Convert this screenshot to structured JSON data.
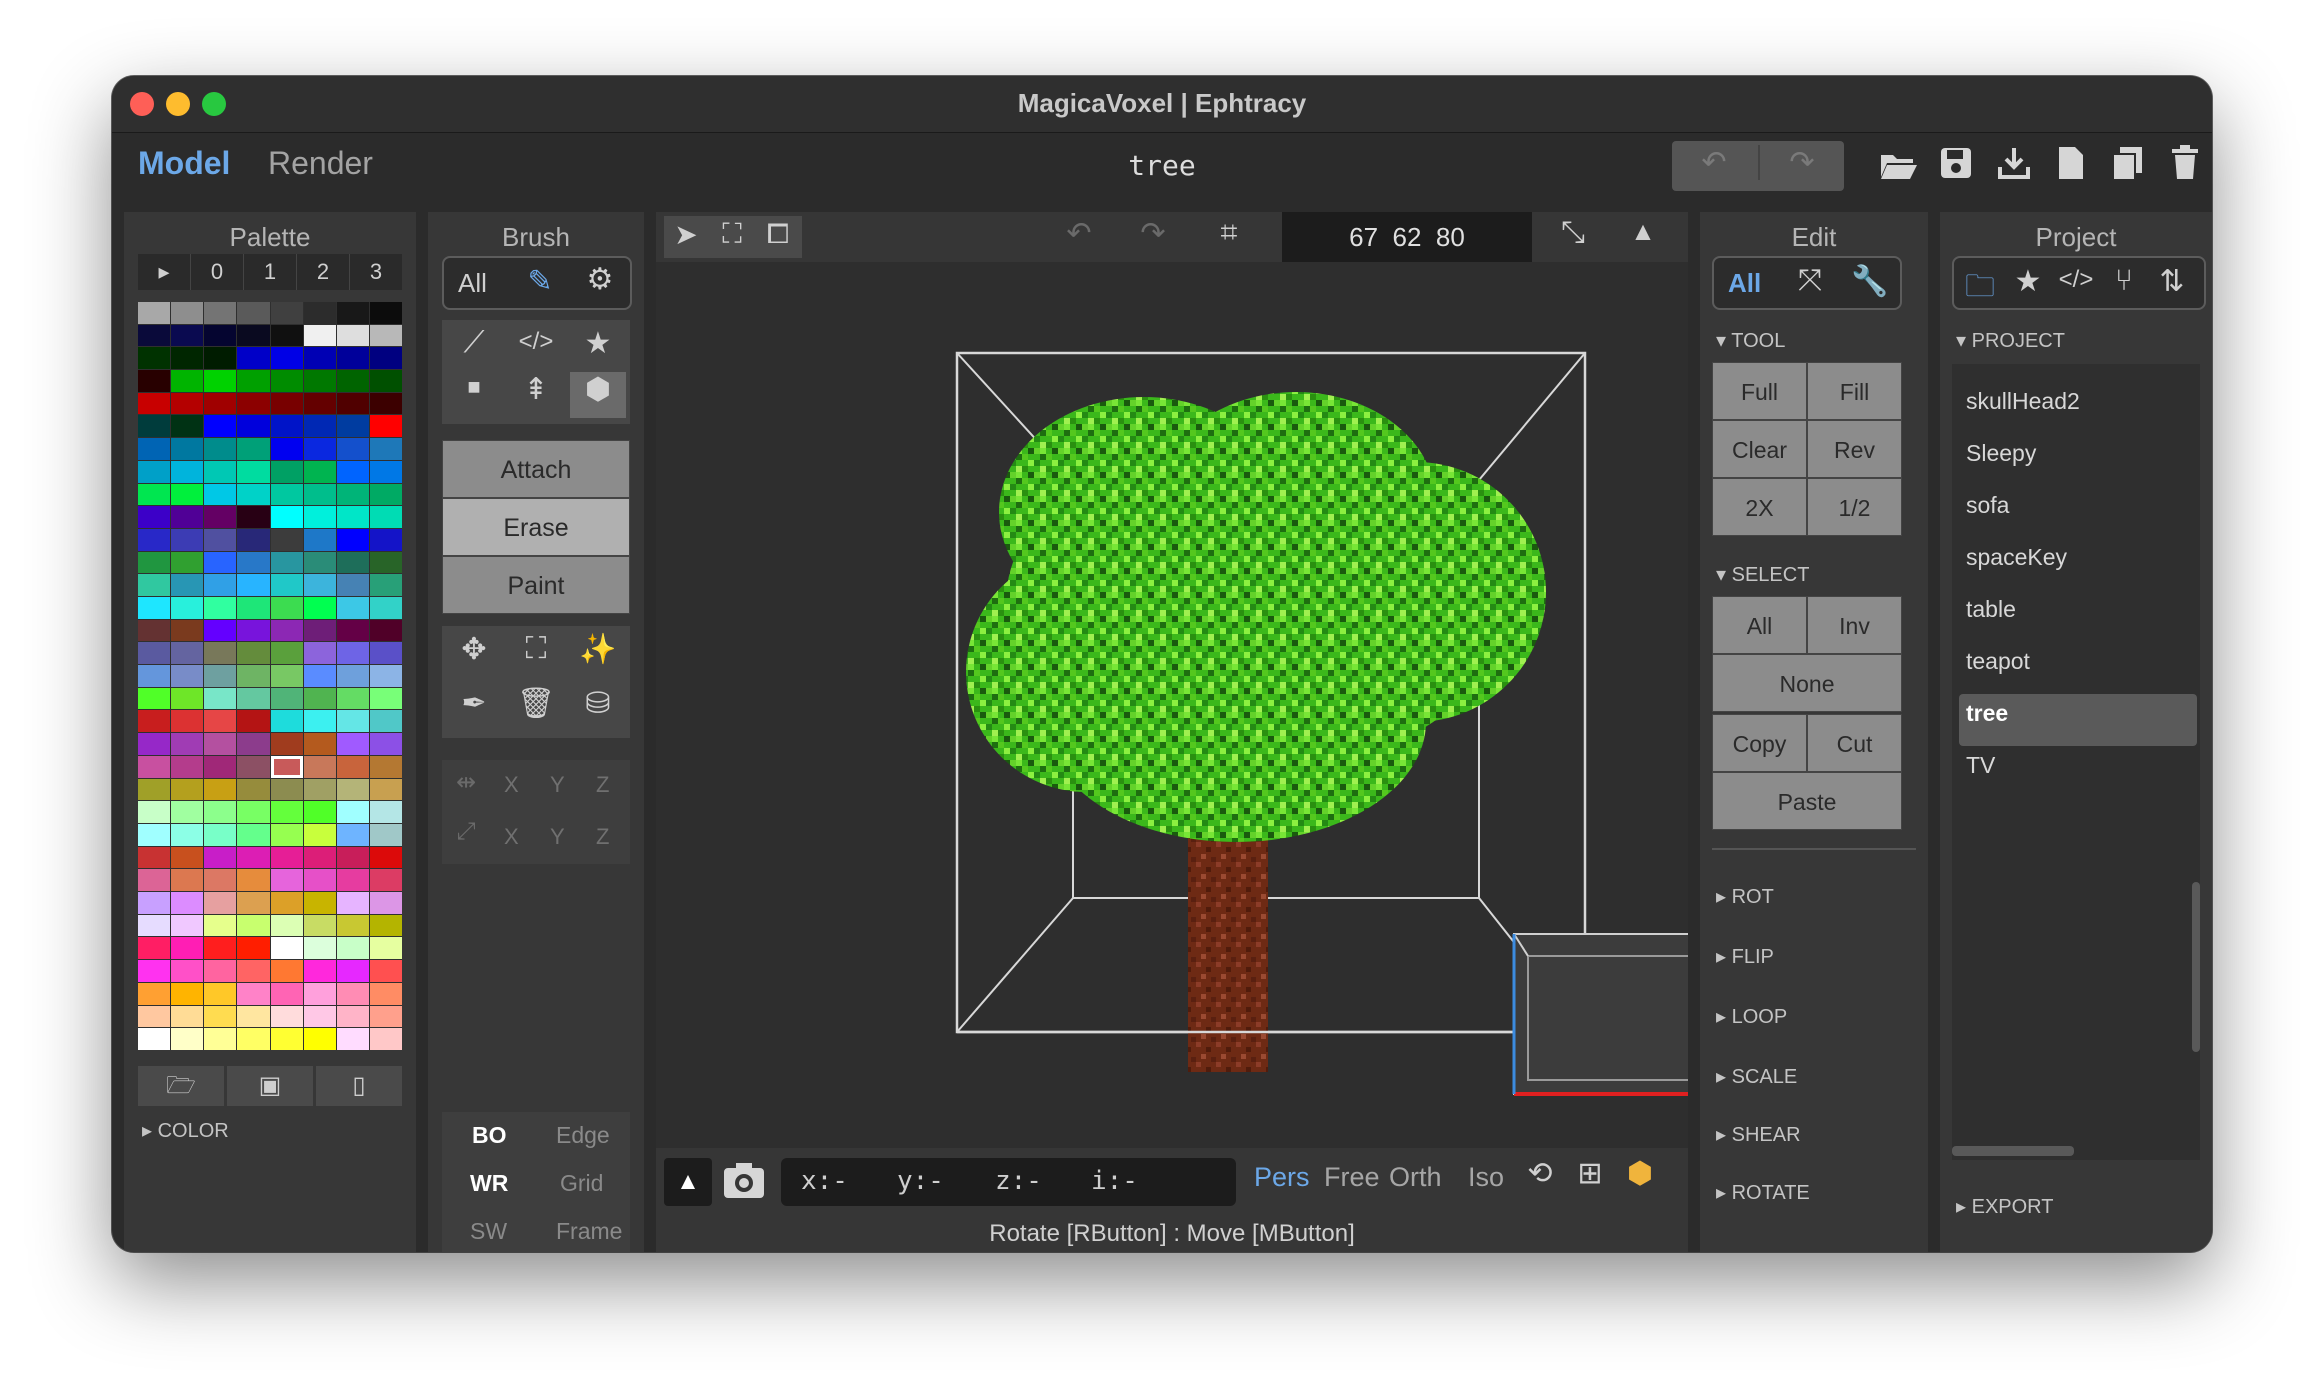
{
  "window": {
    "title": "MagicaVoxel | Ephtracy"
  },
  "menubar": {
    "mode_model": "Model",
    "mode_render": "Render",
    "document_title": "tree"
  },
  "palette": {
    "title": "Palette",
    "tabs": [
      "▸",
      "0",
      "1",
      "2",
      "3"
    ],
    "footer_label": "COLOR",
    "selected_index": 164,
    "colors": [
      "#a8a8a8",
      "#8e8e8e",
      "#747474",
      "#5a5a5a",
      "#404040",
      "#2c2c2c",
      "#181818",
      "#0c0c0c",
      "#0a0a3a",
      "#0a0a50",
      "#050530",
      "#0a0a20",
      "#101010",
      "#f0f0f0",
      "#dedede",
      "#b8b8b8",
      "#003200",
      "#002600",
      "#001c00",
      "#0000c8",
      "#0000e6",
      "#0000b4",
      "#00009a",
      "#000080",
      "#280000",
      "#00b400",
      "#00d200",
      "#00a000",
      "#008c00",
      "#007800",
      "#006400",
      "#005000",
      "#c80000",
      "#b40000",
      "#a00000",
      "#8c0000",
      "#780000",
      "#640000",
      "#500000",
      "#3c0000",
      "#003c3c",
      "#003214",
      "#0000ff",
      "#0000dc",
      "#0014c8",
      "#0028b4",
      "#003ca0",
      "#ff0000",
      "#0064b4",
      "#0078a0",
      "#008c8c",
      "#00a078",
      "#0000f0",
      "#0a28e0",
      "#1450cc",
      "#1e78b8",
      "#00a0c8",
      "#00b4dc",
      "#00c8b4",
      "#00dca0",
      "#00a064",
      "#00b450",
      "#0064ff",
      "#0078e6",
      "#00e650",
      "#00f03c",
      "#00c8e6",
      "#00d2c8",
      "#00c8a0",
      "#00be8c",
      "#00b478",
      "#00aa64",
      "#3c00c8",
      "#500096",
      "#640064",
      "#280014",
      "#00ffff",
      "#00f0dc",
      "#00e6c8",
      "#00dcb4",
      "#2828c8",
      "#3c3cb4",
      "#5050a0",
      "#282878",
      "#3c3c3c",
      "#1e78c8",
      "#0000ff",
      "#1414c8",
      "#209640",
      "#30a030",
      "#2864ff",
      "#2878c8",
      "#2896a0",
      "#2a8c78",
      "#1e6e5a",
      "#286428",
      "#30c8a0",
      "#2896b4",
      "#30a0e6",
      "#28b4ff",
      "#20c8c8",
      "#3cb4dc",
      "#4682b4",
      "#28a078",
      "#1ee6ff",
      "#28f0dc",
      "#30ffa0",
      "#1ee678",
      "#3cdc50",
      "#00ff50",
      "#3cc8e6",
      "#32d2c8",
      "#643232",
      "#7a3a1e",
      "#6400ff",
      "#7814dc",
      "#8c28b4",
      "#6e1e78",
      "#640046",
      "#500028",
      "#5a5aa0",
      "#6464a0",
      "#78785a",
      "#648c3c",
      "#5aa03c",
      "#8c64dc",
      "#6e64e6",
      "#5a50c8",
      "#6496dc",
      "#788cc8",
      "#6ea0a0",
      "#6eb464",
      "#78c864",
      "#5a8cff",
      "#6ea0dc",
      "#8cb4e6",
      "#50ff28",
      "#6ee628",
      "#78e6c8",
      "#64c8a0",
      "#50b478",
      "#50b450",
      "#64dc64",
      "#78ff78",
      "#c81e1e",
      "#dc3232",
      "#e64646",
      "#b41414",
      "#1edcdc",
      "#3cf0f0",
      "#64e6e6",
      "#50c8c8",
      "#9628c8",
      "#a03cb4",
      "#b450a0",
      "#8c3c8c",
      "#a03c1e",
      "#b45a1e",
      "#a05aff",
      "#8c50e6",
      "#c850a0",
      "#b43c8c",
      "#a02878",
      "#8c5064",
      "#c85a5a",
      "#c8785a",
      "#c8643c",
      "#b47832",
      "#a0a028",
      "#b4a01e",
      "#c8a014",
      "#968c3c",
      "#8c8c50",
      "#a0a064",
      "#b4b478",
      "#c8a050",
      "#c8ffc8",
      "#a0ffa0",
      "#8cff8c",
      "#78ff64",
      "#64ff3c",
      "#50ff28",
      "#a0ffff",
      "#b4e6e6",
      "#a0ffff",
      "#8cffe6",
      "#78ffc8",
      "#64ff8c",
      "#96ff50",
      "#c8ff3c",
      "#6eb4ff",
      "#a0c8c8",
      "#c83232",
      "#c8501e",
      "#c81ec8",
      "#dc1eb4",
      "#e61e96",
      "#dc1e78",
      "#c81e5a",
      "#dc0a0a",
      "#dc6496",
      "#dc7850",
      "#dc7864",
      "#e68c3c",
      "#e664dc",
      "#e650c8",
      "#e63ca0",
      "#dc3c64",
      "#c8a0ff",
      "#dc8cff",
      "#e6a0a0",
      "#dca050",
      "#dca028",
      "#c8b400",
      "#e6b4ff",
      "#dc96e6",
      "#e6dcff",
      "#f0c8ff",
      "#e6ff8c",
      "#c8ff6e",
      "#dcffb4",
      "#c8dc64",
      "#c8c832",
      "#b4b400",
      "#ff1e64",
      "#ff1eb4",
      "#ff1e1e",
      "#ff1e00",
      "#ffffff",
      "#dcffdc",
      "#c8ffc8",
      "#e6ffa0",
      "#ff32f0",
      "#ff50c8",
      "#ff64a0",
      "#ff6464",
      "#ff7832",
      "#ff28dc",
      "#e628ff",
      "#ff5050",
      "#ffa032",
      "#ffb400",
      "#ffc828",
      "#ff82c8",
      "#ff64b4",
      "#ffa0dc",
      "#ff8cb4",
      "#ff8c64",
      "#ffc8a0",
      "#ffdc96",
      "#ffdc50",
      "#ffe6a0",
      "#ffdcdc",
      "#ffc8e6",
      "#ffb4c8",
      "#ffa08c",
      "#ffffff",
      "#ffffc8",
      "#ffff96",
      "#ffff64",
      "#ffff32",
      "#ffff00",
      "#ffdcff",
      "#ffc8c8"
    ]
  },
  "brush": {
    "title": "Brush",
    "mode_all": "All",
    "attach": "Attach",
    "erase": "Erase",
    "paint": "Paint",
    "axis_x": "X",
    "axis_y": "Y",
    "axis_z": "Z",
    "bo": "BO",
    "edge": "Edge",
    "wr": "WR",
    "grid": "Grid",
    "sw": "SW",
    "frame": "Frame"
  },
  "viewport": {
    "dims": "67  62  80",
    "coords": {
      "x": "x:-",
      "y": "y:-",
      "z": "z:-",
      "i": "i:-"
    },
    "views": [
      "Pers",
      "Free",
      "Orth",
      "Iso"
    ],
    "status": "Rotate [RButton] : Move [MButton]"
  },
  "edit": {
    "title": "Edit",
    "mode_all": "All",
    "tool_header": "TOOL",
    "tool_buttons": [
      "Full",
      "Fill",
      "Clear",
      "Rev",
      "2X",
      "1/2"
    ],
    "select_header": "SELECT",
    "select_all": "All",
    "select_inv": "Inv",
    "select_none": "None",
    "copy": "Copy",
    "cut": "Cut",
    "paste": "Paste",
    "sections": [
      "ROT",
      "FLIP",
      "LOOP",
      "SCALE",
      "SHEAR",
      "ROTATE"
    ]
  },
  "project": {
    "title": "Project",
    "header": "PROJECT",
    "items": [
      "skullHead2",
      "Sleepy",
      "sofa",
      "spaceKey",
      "table",
      "teapot",
      "tree",
      "TV"
    ],
    "selected": "tree",
    "export": "EXPORT"
  },
  "colors": {
    "accent": "#6ca8e8",
    "leaf_green": "#3bb81b",
    "trunk_brown": "#6e2a14",
    "cube_accent": "#f0b43c"
  }
}
